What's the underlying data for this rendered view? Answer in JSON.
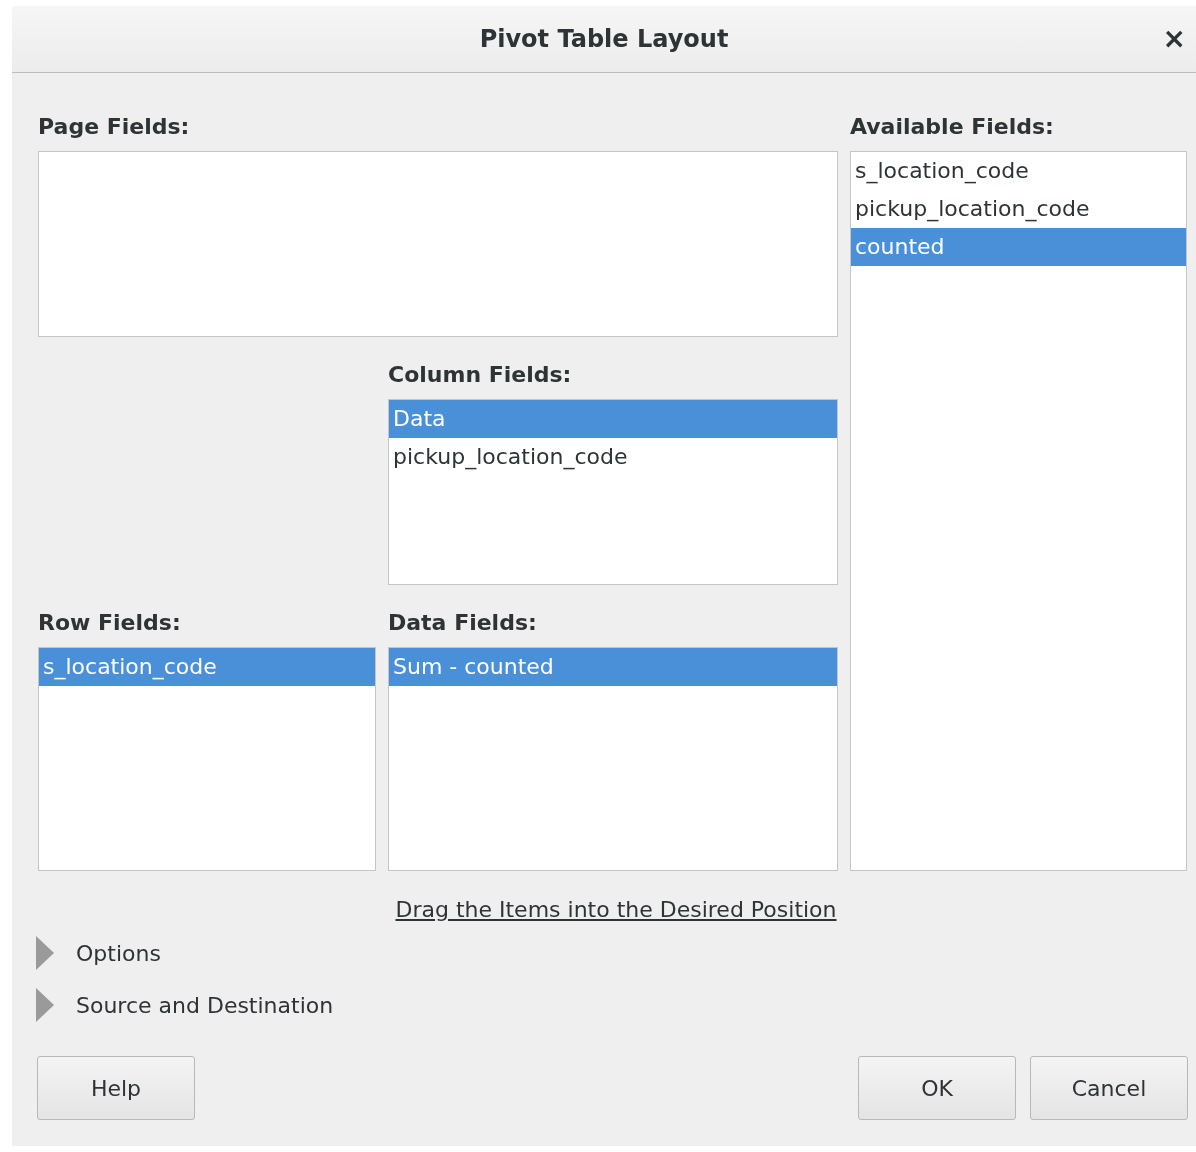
{
  "window": {
    "title": "Pivot Table Layout",
    "close": "×"
  },
  "page_fields": {
    "label": "Page Fields:"
  },
  "available_fields": {
    "label": "Available Fields:",
    "items": [
      {
        "text": "s_location_code",
        "selected": false
      },
      {
        "text": "pickup_location_code",
        "selected": false
      },
      {
        "text": "counted",
        "selected": true
      }
    ]
  },
  "column_fields": {
    "label": "Column Fields:",
    "items": [
      {
        "text": "Data",
        "selected": true
      },
      {
        "text": "pickup_location_code",
        "selected": false
      }
    ]
  },
  "row_fields": {
    "label": "Row Fields:",
    "items": [
      {
        "text": "s_location_code",
        "selected": true
      }
    ]
  },
  "data_fields": {
    "label": "Data Fields:",
    "items": [
      {
        "text": "Sum - counted",
        "selected": true
      }
    ]
  },
  "hint_link": "Drag the Items into the Desired Position",
  "expanders": [
    {
      "label": "Options",
      "expanded": false
    },
    {
      "label": "Source and Destination",
      "expanded": false
    }
  ],
  "buttons": [
    {
      "label": "Help",
      "kind": "left"
    },
    {
      "label": "OK",
      "kind": "right"
    },
    {
      "label": "Cancel",
      "kind": "right"
    }
  ]
}
